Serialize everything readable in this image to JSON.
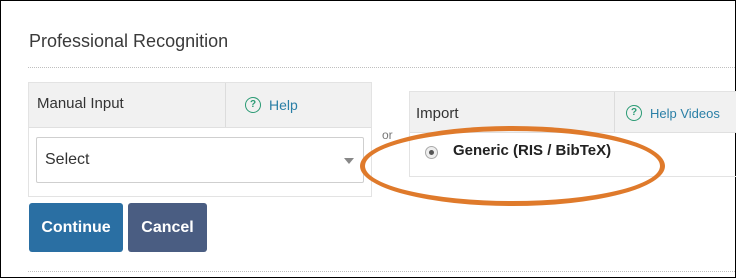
{
  "section": {
    "title": "Professional Recognition"
  },
  "manual": {
    "label": "Manual Input",
    "help_label": "Help",
    "select_value": "Select"
  },
  "separator": {
    "or_text": "or"
  },
  "import": {
    "label": "Import",
    "help_label": "Help Videos",
    "option_label": "Generic (RIS / BibTeX)",
    "option_selected": true
  },
  "actions": {
    "continue_label": "Continue",
    "cancel_label": "Cancel"
  },
  "colors": {
    "continue_button": "#2a6fa3",
    "cancel_button": "#4a5d82",
    "help_icon": "#2a9a74",
    "highlight": "#df7a2b"
  },
  "icons": {
    "help": "help-circle-icon",
    "dropdown": "chevron-down-icon"
  }
}
